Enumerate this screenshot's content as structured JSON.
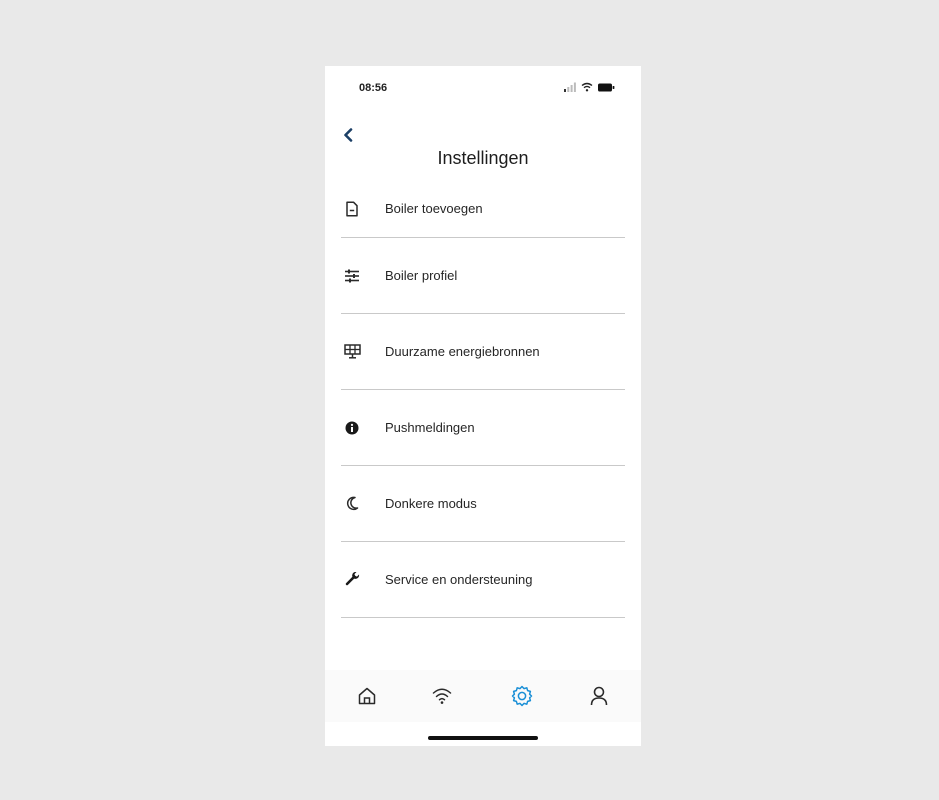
{
  "status_bar": {
    "time": "08:56"
  },
  "header": {
    "title": "Instellingen"
  },
  "menu": {
    "items": [
      {
        "label": "Boiler toevoegen",
        "icon": "document-icon"
      },
      {
        "label": "Boiler profiel",
        "icon": "sliders-icon"
      },
      {
        "label": "Duurzame energiebronnen",
        "icon": "solar-panel-icon"
      },
      {
        "label": "Pushmeldingen",
        "icon": "info-icon"
      },
      {
        "label": "Donkere modus",
        "icon": "moon-icon"
      },
      {
        "label": "Service en ondersteuning",
        "icon": "wrench-icon"
      }
    ]
  },
  "tabbar": {
    "tabs": [
      {
        "icon": "home-icon",
        "active": false
      },
      {
        "icon": "wifi-icon",
        "active": false
      },
      {
        "icon": "settings-icon",
        "active": true
      },
      {
        "icon": "user-icon",
        "active": false
      }
    ]
  },
  "colors": {
    "accent": "#1a8fd6",
    "back_arrow": "#1c3f66",
    "divider": "#c9c9c9",
    "icon": "#2a2a2a"
  }
}
